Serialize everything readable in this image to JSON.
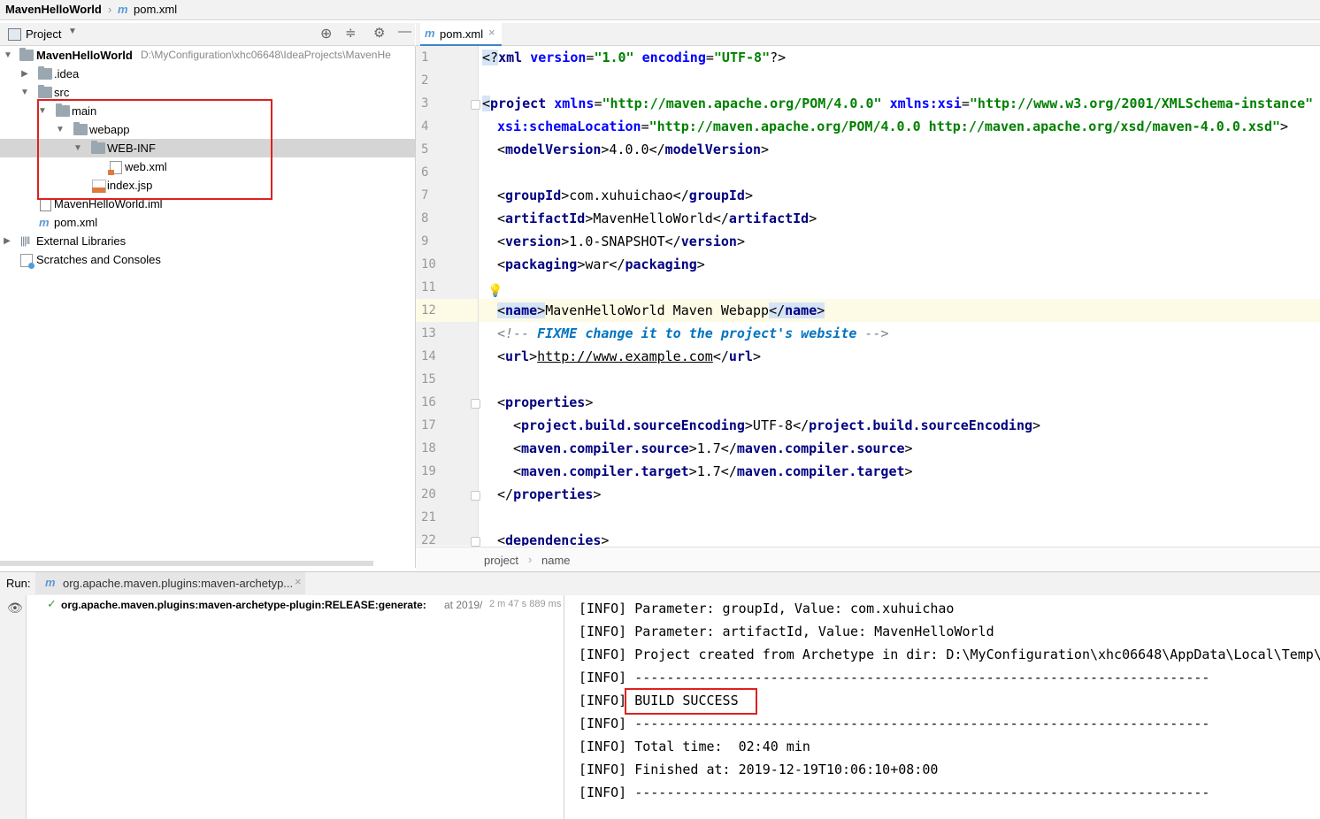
{
  "breadcrumb": {
    "project": "MavenHelloWorld",
    "file_icon": "m",
    "file": "pom.xml"
  },
  "project_panel": {
    "title": "Project",
    "tree": [
      {
        "label": "MavenHelloWorld",
        "path": "D:\\MyConfiguration\\xhc06648\\IdeaProjects\\MavenHe"
      },
      {
        "label": ".idea"
      },
      {
        "label": "src"
      },
      {
        "label": "main"
      },
      {
        "label": "webapp"
      },
      {
        "label": "WEB-INF"
      },
      {
        "label": "web.xml"
      },
      {
        "label": "index.jsp"
      },
      {
        "label": "MavenHelloWorld.iml"
      },
      {
        "label": "pom.xml"
      },
      {
        "label": "External Libraries"
      },
      {
        "label": "Scratches and Consoles"
      }
    ]
  },
  "editor": {
    "tab": {
      "icon": "m",
      "label": "pom.xml",
      "close": "×"
    },
    "line_numbers": [
      "1",
      "2",
      "3",
      "4",
      "5",
      "6",
      "7",
      "8",
      "9",
      "10",
      "11",
      "12",
      "13",
      "14",
      "15",
      "16",
      "17",
      "18",
      "19",
      "20",
      "21",
      "22"
    ],
    "breadcrumb": [
      "project",
      "name"
    ]
  },
  "run_panel": {
    "label": "Run:",
    "tab_icon": "m",
    "tab_label": "org.apache.maven.plugins:maven-archetyp...",
    "tab_close": "×",
    "task": {
      "name": "org.apache.maven.plugins:maven-archetype-plugin:RELEASE:generate:",
      "at": "at 2019/",
      "duration": "2 m 47 s 889 ms"
    },
    "console": [
      "[INFO] Parameter: groupId, Value: com.xuhuichao",
      "[INFO] Parameter: artifactId, Value: MavenHelloWorld",
      "[INFO] Project created from Archetype in dir: D:\\MyConfiguration\\xhc06648\\AppData\\Local\\Temp\\a",
      "[INFO] ------------------------------------------------------------------------",
      "[INFO] BUILD SUCCESS",
      "[INFO] ------------------------------------------------------------------------",
      "[INFO] Total time:  02:40 min",
      "[INFO] Finished at: 2019-12-19T10:06:10+08:00",
      "[INFO] ------------------------------------------------------------------------"
    ]
  },
  "colors": {
    "highlight_box": "#e02020",
    "tab_underline": "#4083c9",
    "tag": "#000080",
    "string": "#008000"
  }
}
